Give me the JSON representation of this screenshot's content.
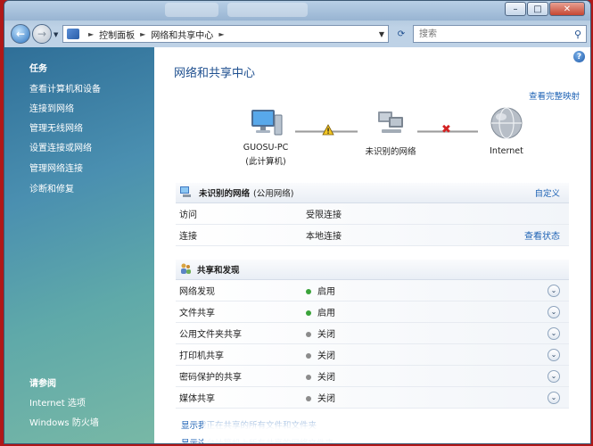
{
  "navbar": {
    "breadcrumb": [
      "控制面板",
      "网络和共享中心"
    ],
    "search_placeholder": "搜索"
  },
  "sidebar": {
    "tasks_heading": "任务",
    "tasks": [
      "查看计算机和设备",
      "连接到网络",
      "管理无线网络",
      "设置连接或网络",
      "管理网络连接",
      "诊断和修复"
    ],
    "see_also_heading": "请参阅",
    "see_also": [
      "Internet 选项",
      "Windows 防火墙"
    ]
  },
  "main": {
    "title": "网络和共享中心",
    "full_map_link": "查看完整映射",
    "map": {
      "computer_name": "GUOSU-PC",
      "computer_sub": "(此计算机)",
      "network_label": "未识别的网络",
      "internet_label": "Internet"
    },
    "network": {
      "name": "未识别的网络",
      "type": "(公用网络)",
      "customize": "自定义",
      "rows": [
        {
          "label": "访问",
          "value": "受限连接",
          "action": ""
        },
        {
          "label": "连接",
          "value": "本地连接",
          "action": "查看状态"
        }
      ]
    },
    "sharing": {
      "heading": "共享和发现",
      "rows": [
        {
          "label": "网络发现",
          "value": "启用",
          "on": true
        },
        {
          "label": "文件共享",
          "value": "启用",
          "on": true
        },
        {
          "label": "公用文件夹共享",
          "value": "关闭",
          "on": false
        },
        {
          "label": "打印机共享",
          "value": "关闭",
          "on": false
        },
        {
          "label": "密码保护的共享",
          "value": "关闭",
          "on": false
        },
        {
          "label": "媒体共享",
          "value": "关闭",
          "on": false
        }
      ]
    },
    "footer_links": [
      "显示我正在共享的所有文件和文件夹",
      "显示这台计算机上所有共享的网络文件夹"
    ]
  },
  "colors": {
    "status_on": "#3aa33a",
    "status_off": "#8c8c8c",
    "link": "#1c61b4"
  }
}
